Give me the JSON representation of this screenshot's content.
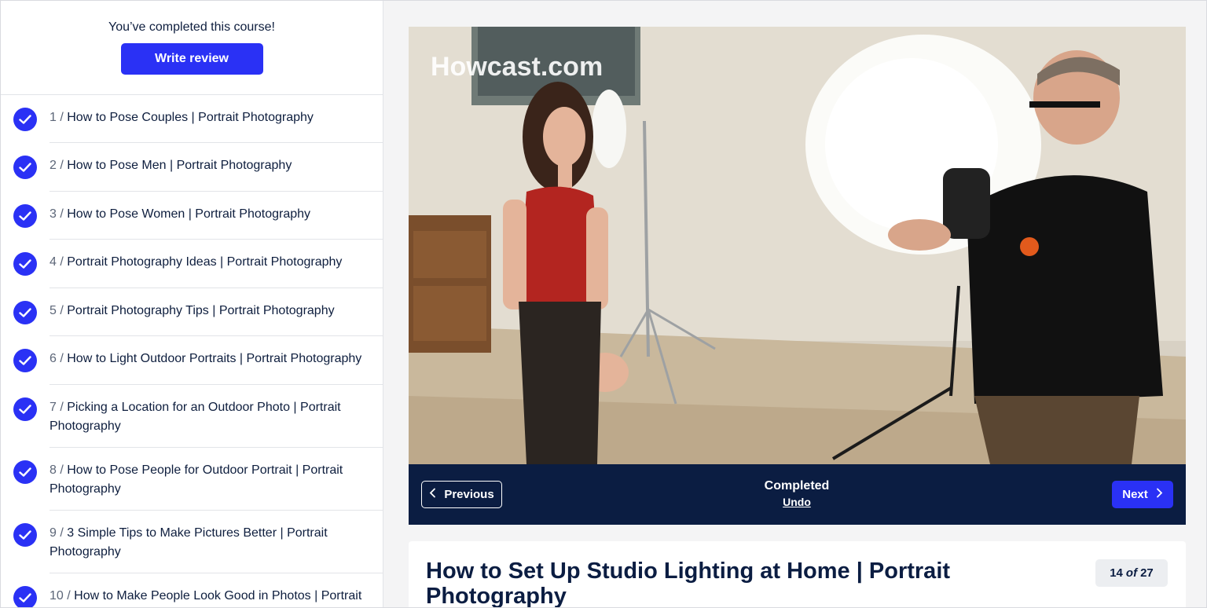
{
  "sidebar": {
    "completion_text": "You’ve completed this course!",
    "review_label": "Write review",
    "lessons": [
      {
        "num": "1 /",
        "title": "How to Pose Couples | Portrait Photography"
      },
      {
        "num": "2 /",
        "title": "How to Pose Men | Portrait Photography"
      },
      {
        "num": "3 /",
        "title": "How to Pose Women | Portrait Photography"
      },
      {
        "num": "4 /",
        "title": "Portrait Photography Ideas | Portrait Photography"
      },
      {
        "num": "5 /",
        "title": "Portrait Photography Tips | Portrait Photography"
      },
      {
        "num": "6 /",
        "title": "How to Light Outdoor Portraits | Portrait Photography"
      },
      {
        "num": "7 /",
        "title": "Picking a Location for an Outdoor Photo | Portrait Photography"
      },
      {
        "num": "8 /",
        "title": "How to Pose People for Outdoor Portrait | Portrait Photography"
      },
      {
        "num": "9 /",
        "title": "3 Simple Tips to Make Pictures Better | Portrait Photography"
      },
      {
        "num": "10 /",
        "title": "How to Make People Look Good in Photos | Portrait"
      }
    ]
  },
  "video": {
    "watermark": "Howcast.com"
  },
  "controls": {
    "previous_label": "Previous",
    "next_label": "Next",
    "status_label": "Completed",
    "undo_label": "Undo"
  },
  "lesson_info": {
    "title": "How to Set Up Studio Lighting at Home | Portrait Photography",
    "counter_current": "14",
    "counter_of": "of",
    "counter_total": "27"
  },
  "colors": {
    "accent": "#2a31f5",
    "nav_bar": "#0b1d42",
    "text": "#0e1e3e"
  },
  "icons": {
    "lesson_status": "check-circle-icon",
    "previous": "chevron-left-icon",
    "next": "chevron-right-icon"
  }
}
